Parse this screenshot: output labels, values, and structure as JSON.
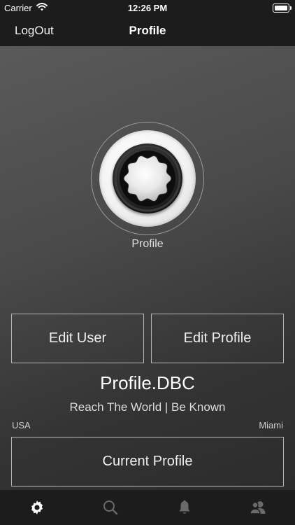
{
  "status_bar": {
    "carrier": "Carrier",
    "time": "12:26 PM"
  },
  "nav": {
    "left_button": "LogOut",
    "title": "Profile"
  },
  "avatar": {
    "caption": "Profile"
  },
  "buttons": {
    "edit_user": "Edit User",
    "edit_profile": "Edit Profile",
    "current_profile": "Current Profile"
  },
  "profile": {
    "name": "Profile.DBC",
    "tagline": "Reach The World | Be Known",
    "country": "USA",
    "city": "Miami"
  },
  "tabbar": {
    "tabs": [
      {
        "icon": "gear-icon",
        "active": true
      },
      {
        "icon": "search-icon",
        "active": false
      },
      {
        "icon": "bell-icon",
        "active": false
      },
      {
        "icon": "users-icon",
        "active": false
      }
    ]
  },
  "colors": {
    "active_tab": "#ffffff",
    "inactive_tab": "#6a6a6a",
    "bar_bg": "#1c1c1c"
  }
}
